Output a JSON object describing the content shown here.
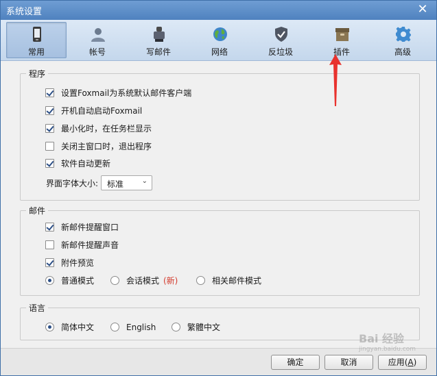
{
  "window": {
    "title": "系统设置",
    "close_glyph": "✕"
  },
  "tabs": [
    {
      "label": "常用",
      "icon": "phone-icon"
    },
    {
      "label": "帐号",
      "icon": "user-icon"
    },
    {
      "label": "写邮件",
      "icon": "compose-icon"
    },
    {
      "label": "网络",
      "icon": "globe-icon"
    },
    {
      "label": "反垃圾",
      "icon": "shield-icon"
    },
    {
      "label": "插件",
      "icon": "box-icon"
    },
    {
      "label": "高级",
      "icon": "gear-icon"
    }
  ],
  "program": {
    "title": "程序",
    "set_default": "设置Foxmail为系统默认邮件客户端",
    "autostart": "开机自动启动Foxmail",
    "minimize_tray": "最小化时，在任务栏显示",
    "close_exit": "关闭主窗口时，退出程序",
    "auto_update": "软件自动更新",
    "font_size_label": "界面字体大小:",
    "font_size_value": "标准"
  },
  "mail": {
    "title": "邮件",
    "new_mail_popup": "新邮件提醒窗口",
    "new_mail_sound": "新邮件提醒声音",
    "attachment_preview": "附件预览",
    "mode_normal": "普通模式",
    "mode_conversation": "会话模式",
    "mode_new_badge": "(新)",
    "mode_related": "相关邮件模式"
  },
  "language": {
    "title": "语言",
    "simplified": "简体中文",
    "english": "English",
    "traditional": "繁體中文"
  },
  "footer": {
    "ok": "确定",
    "cancel": "取消",
    "apply": "应用(",
    "apply_key": "A",
    "apply_end": ")"
  },
  "watermark": {
    "main": "Bai 经验",
    "sub": "jingyan.baidu.com"
  },
  "colors": {
    "arrow": "#e8322e",
    "accent": "#2c4f86"
  }
}
